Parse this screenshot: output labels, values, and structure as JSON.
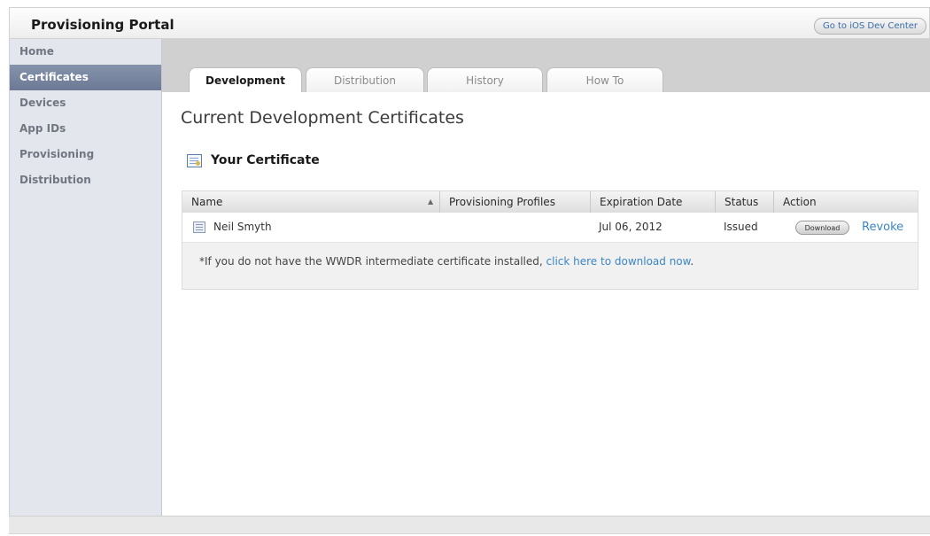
{
  "header": {
    "title": "Provisioning Portal",
    "dev_center_label": "Go to iOS Dev Center"
  },
  "sidebar": {
    "items": [
      {
        "label": "Home"
      },
      {
        "label": "Certificates"
      },
      {
        "label": "Devices"
      },
      {
        "label": "App IDs"
      },
      {
        "label": "Provisioning"
      },
      {
        "label": "Distribution"
      }
    ],
    "active_index": 1
  },
  "tabs": [
    {
      "label": "Development"
    },
    {
      "label": "Distribution"
    },
    {
      "label": "History"
    },
    {
      "label": "How To"
    }
  ],
  "page": {
    "title": "Current Development Certificates",
    "section_heading": "Your Certificate"
  },
  "table": {
    "headers": [
      "Name",
      "Provisioning Profiles",
      "Expiration Date",
      "Status",
      "Action"
    ],
    "rows": [
      {
        "name": "Neil Smyth",
        "provisioning_profiles": "",
        "expiration_date": "Jul 06, 2012",
        "status": "Issued",
        "download_label": "Download",
        "revoke_label": "Revoke"
      }
    ]
  },
  "note": {
    "text": "*If you do not have the WWDR intermediate certificate installed, ",
    "link": "click here to download now",
    "suffix": "."
  },
  "icons": {
    "certificate_heading": "certificate-icon",
    "row": "certificate-file-icon",
    "sort": "sort-ascending-icon"
  },
  "colors": {
    "sidebar_active": "#7382a0",
    "link": "#3b86c6",
    "tabbar": "#d0d0d0"
  }
}
